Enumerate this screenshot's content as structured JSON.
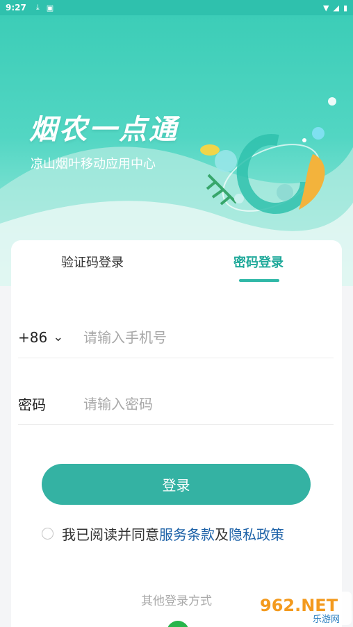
{
  "status_bar": {
    "time": "9:27",
    "download_icon": "download-icon",
    "a_icon": "a-icon",
    "wifi_icon": "wifi-icon",
    "signal_icon": "signal-icon",
    "battery_icon": "battery-icon"
  },
  "header": {
    "title": "烟农一点通",
    "subtitle": "凉山烟叶移动应用中心"
  },
  "tabs": [
    {
      "label": "验证码登录",
      "active": false
    },
    {
      "label": "密码登录",
      "active": true
    }
  ],
  "phone": {
    "prefix": "+86",
    "placeholder": "请输入手机号",
    "value": ""
  },
  "password": {
    "label": "密码",
    "placeholder": "请输入密码",
    "value": ""
  },
  "login_button": "登录",
  "agreement": {
    "text_before": "我已阅读并同意",
    "terms": "服务条款",
    "and": "及",
    "privacy": "隐私政策"
  },
  "other_login": "其他登录方式",
  "watermark": {
    "brand": "962.NET",
    "subtext": "乐游网"
  },
  "colors": {
    "accent": "#34b2a3",
    "header": "#3ccdb7",
    "link": "#1f63a8"
  }
}
